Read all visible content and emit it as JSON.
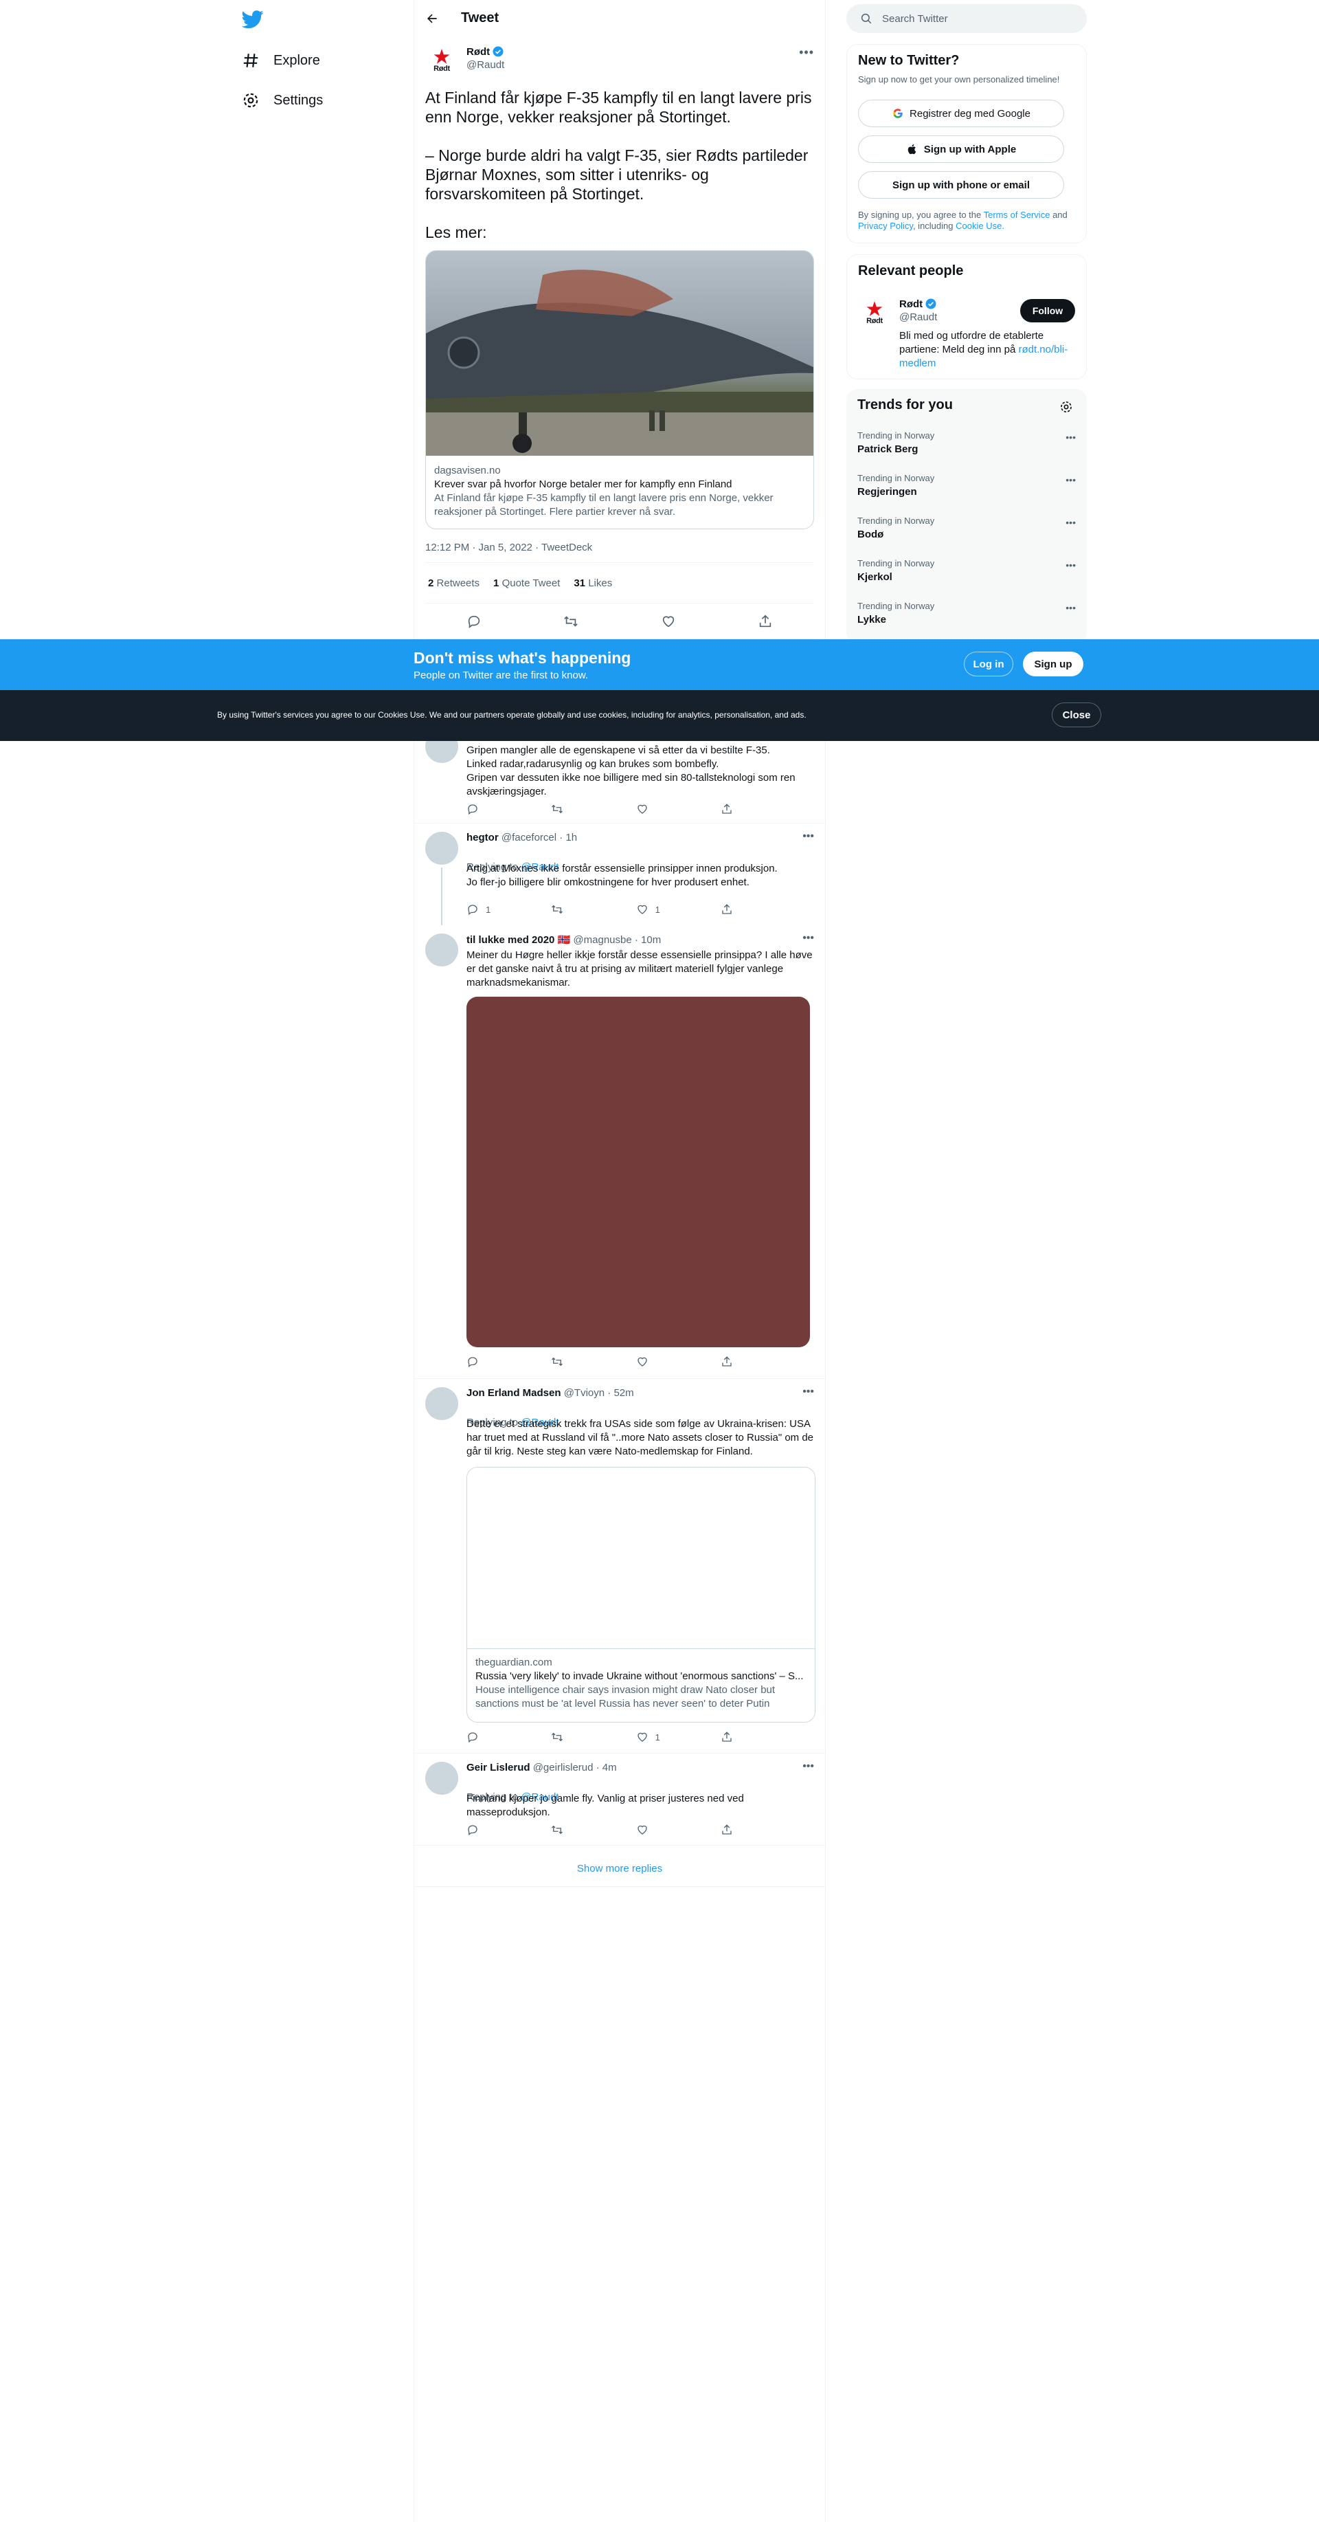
{
  "nav": {
    "explore_label": "Explore",
    "settings_label": "Settings"
  },
  "header": {
    "title": "Tweet"
  },
  "tweet": {
    "author_name": "Rødt",
    "author_handle": "@Raudt",
    "avatar_word": "Rødt",
    "text": "At Finland får kjøpe F-35 kampfly til en langt lavere pris enn Norge, vekker reaksjoner på Stortinget.\n\n– Norge burde aldri ha valgt F-35, sier Rødts partileder Bjørnar Moxnes, som sitter i utenriks- og forsvarskomiteen på Stortinget.\n\nLes mer:",
    "card_domain": "dagsavisen.no",
    "card_title": "Krever svar på hvorfor Norge betaler mer for kampfly enn Finland",
    "card_desc": "At Finland får kjøpe F-35 kampfly til en langt lavere pris enn Norge, vekker reaksjoner på Stortinget. Flere partier krever nå svar.",
    "timestamp": "12:12 PM · Jan 5, 2022 · TweetDeck",
    "retweets": "2",
    "retweets_label": "Retweets",
    "quotes": "1",
    "quotes_label": "Quote Tweet",
    "likes": "31",
    "likes_label": "Likes"
  },
  "replies": [
    {
      "text": "Gripen mangler alle de egenskapene vi så etter  da vi bestilte F-35.\nLinked radar,radarusynlig og kan brukes som bombefly.\nGripen var dessuten ikke noe billigere med sin 80-tallsteknologi som ren avskjæringsjager."
    },
    {
      "name": "hegtor",
      "handle": "@faceforcel · 1h",
      "replying_prefix": "Replying to",
      "replying_to": "@Raudt",
      "text": "Artig at Moxnes ikke forstår essensielle prinsipper innen produksjon.\n Jo fler-jo billigere blir omkostningene for hver produsert enhet.",
      "reply_count": "1",
      "like_count": "1"
    },
    {
      "name": "til lukke med 2020 🇳🇴",
      "handle": "@magnusbe · 10m",
      "text": "Meiner du Høgre heller ikkje forstår desse essensielle prinsippa? I alle høve er det ganske naivt å tru at prising av militært materiell fylgjer vanlege marknadsmekanismar."
    },
    {
      "name": "Jon Erland Madsen",
      "handle": "@Tvioyn · 52m",
      "replying_prefix": "Replying to",
      "replying_to": "@Raudt",
      "text": "Dette er et strategisk trekk fra USAs side som følge av Ukraina-krisen: USA har truet med at Russland vil få \"..more Nato assets closer to Russia\" om de går til krig. Neste steg kan være Nato-medlemskap for Finland.",
      "card_domain": "theguardian.com",
      "card_title": "Russia 'very likely' to invade Ukraine without 'enormous sanctions' – S...",
      "card_desc": "House intelligence chair says invasion might draw Nato closer but sanctions must be 'at level Russia has never seen' to deter Putin",
      "like_count": "1"
    },
    {
      "name": "Geir Lislerud",
      "handle": "@geirlislerud · 4m",
      "replying_prefix": "Replying to",
      "replying_to": "@Raudt",
      "text": "Finnland kjøper jo gamle fly. Vanlig at priser justeres ned ved masseproduksjon."
    }
  ],
  "show_more": "Show more replies",
  "sidebar": {
    "search_placeholder": "Search Twitter",
    "new_title": "New to Twitter?",
    "new_sub": "Sign up now to get your own personalized timeline!",
    "google_btn": "Registrer deg med Google",
    "apple_btn": "Sign up with Apple",
    "phone_btn": "Sign up with phone or email",
    "terms_prefix": "By signing up, you agree to the",
    "terms_link": "Terms of Service",
    "terms_and": "and",
    "privacy_link": "Privacy Policy",
    "terms_including": ", including",
    "cookie_link": "Cookie Use.",
    "people_title": "Relevant people",
    "person_name": "Rødt",
    "person_handle": "@Raudt",
    "follow_btn": "Follow",
    "person_bio": "Bli med og utfordre de etablerte partiene: Meld deg inn på",
    "person_link": "rødt.no/bli-medlem",
    "trends_title": "Trends for you",
    "trends": [
      {
        "meta": "Trending in Norway",
        "name": "Patrick Berg"
      },
      {
        "meta": "Trending in Norway",
        "name": "Regjeringen"
      },
      {
        "meta": "Trending in Norway",
        "name": "Bodø"
      },
      {
        "meta": "Trending in Norway",
        "name": "Kjerkol"
      },
      {
        "meta": "Trending in Norway",
        "name": "Lykke"
      }
    ]
  },
  "signup_bar": {
    "title": "Don't miss what's happening",
    "subtitle": "People on Twitter are the first to know.",
    "login": "Log in",
    "signup": "Sign up"
  },
  "cookie_bar": {
    "text": "By using Twitter's services you agree to our Cookies Use. We and our partners operate globally and use cookies, including for analytics, personalisation, and ads.",
    "close": "Close"
  },
  "colors": {
    "accent": "#1d9bf0",
    "text": "#0f1419",
    "muted": "#536471",
    "cookie_bg": "#15202b",
    "reply_image": "#743b3b"
  }
}
